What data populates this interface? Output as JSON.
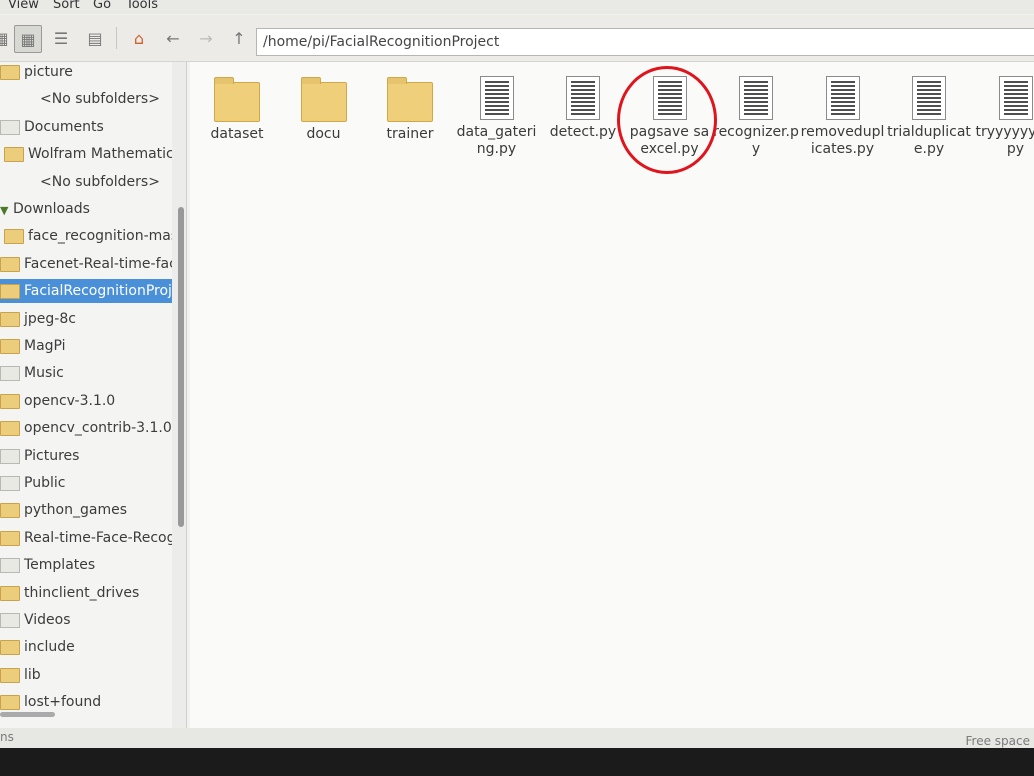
{
  "menu": [
    "View",
    "Sort",
    "Go",
    "Tools"
  ],
  "path": "/home/pi/FacialRecognitionProject",
  "sidebar": [
    {
      "label": "picture",
      "kind": "folder"
    },
    {
      "label": "<No subfolders>",
      "kind": "note"
    },
    {
      "label": "Documents",
      "kind": "special"
    },
    {
      "label": "Wolfram Mathematica",
      "kind": "folder"
    },
    {
      "label": "<No subfolders>",
      "kind": "note"
    },
    {
      "label": "Downloads",
      "kind": "expanded"
    },
    {
      "label": "face_recognition-mast",
      "kind": "folder"
    },
    {
      "label": "Facenet-Real-time-face-",
      "kind": "folder"
    },
    {
      "label": "FacialRecognitionProjec",
      "kind": "folder",
      "selected": true
    },
    {
      "label": "jpeg-8c",
      "kind": "folder"
    },
    {
      "label": "MagPi",
      "kind": "folder"
    },
    {
      "label": "Music",
      "kind": "special"
    },
    {
      "label": "opencv-3.1.0",
      "kind": "folder"
    },
    {
      "label": "opencv_contrib-3.1.0",
      "kind": "folder"
    },
    {
      "label": "Pictures",
      "kind": "special"
    },
    {
      "label": "Public",
      "kind": "special"
    },
    {
      "label": "python_games",
      "kind": "folder"
    },
    {
      "label": "Real-time-Face-Recogni",
      "kind": "folder"
    },
    {
      "label": "Templates",
      "kind": "special"
    },
    {
      "label": "thinclient_drives",
      "kind": "folder"
    },
    {
      "label": "Videos",
      "kind": "special"
    },
    {
      "label": "include",
      "kind": "folder"
    },
    {
      "label": "lib",
      "kind": "folder"
    },
    {
      "label": "lost+found",
      "kind": "folder"
    }
  ],
  "files": [
    {
      "name": "dataset",
      "type": "folder"
    },
    {
      "name": "docu",
      "type": "folder"
    },
    {
      "name": "trainer",
      "type": "folder"
    },
    {
      "name": "data_gatering.py",
      "type": "file"
    },
    {
      "name": "detect.py",
      "type": "file"
    },
    {
      "name": "pagsave sa excel.py",
      "type": "file",
      "highlighted": true
    },
    {
      "name": "recognizer.py",
      "type": "file"
    },
    {
      "name": "removeduplicates.py",
      "type": "file"
    },
    {
      "name": "trialduplicate.py",
      "type": "file"
    },
    {
      "name": "tryyyyyyyy.py",
      "type": "file"
    }
  ],
  "status": {
    "left": "ns",
    "right": "Free space"
  },
  "colors": {
    "selection": "#4a90d9",
    "highlight_circle": "#e0141c",
    "folder": "#f0cf7b"
  }
}
